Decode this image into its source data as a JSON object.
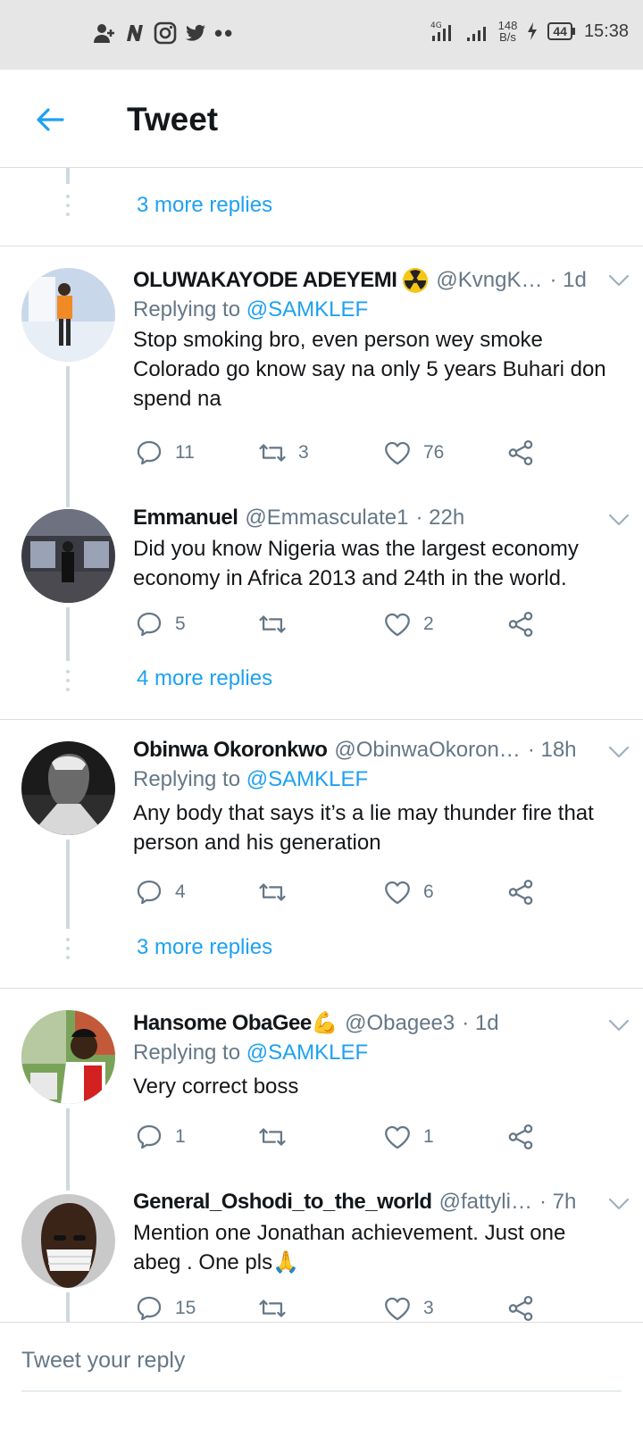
{
  "status_bar": {
    "left_icons": [
      "person-add-icon",
      "n-app-icon",
      "instagram-icon",
      "twitter-icon",
      "more-dots-icon"
    ],
    "network": "4G",
    "speed_value": "148",
    "speed_unit": "B/s",
    "battery": "44",
    "time": "15:38"
  },
  "header": {
    "title": "Tweet",
    "back_icon": "back-arrow-icon"
  },
  "colors": {
    "accent": "#1da1f2",
    "muted": "#657786",
    "text": "#14171a",
    "line": "#cfd9de"
  },
  "top_more_replies": "3 more replies",
  "tweets": [
    {
      "name": "OLUWAKAYODE ADEYEMI",
      "badge": "radioactive-icon",
      "handle": "@KvngK…",
      "time": "· 1d",
      "replying_prefix": "Replying to",
      "replying_to": "@SAMKLEF",
      "text": "Stop smoking bro, even person wey smoke Colorado go know say na only 5 years Buhari don spend na",
      "replies": "11",
      "retweets": "3",
      "likes": "76"
    },
    {
      "name": "Emmanuel",
      "handle": "@Emmasculate1",
      "time": "· 22h",
      "text": "Did you know Nigeria was the largest economy economy in Africa 2013 and 24th in the world.",
      "replies": "5",
      "retweets": "",
      "likes": "2",
      "more_replies": "4 more replies"
    },
    {
      "name": "Obinwa Okoronkwo",
      "handle": "@ObinwaOkoron…",
      "time": "· 18h",
      "replying_prefix": "Replying to",
      "replying_to": "@SAMKLEF",
      "text": "Any body that says it’s a lie may thunder fire that person and his generation",
      "replies": "4",
      "retweets": "",
      "likes": "6",
      "more_replies": "3 more replies"
    },
    {
      "name": "Hansome ObaGee💪",
      "handle": "@Obagee3",
      "time": "· 1d",
      "replying_prefix": "Replying to",
      "replying_to": "@SAMKLEF",
      "text": "Very correct boss",
      "replies": "1",
      "retweets": "",
      "likes": "1"
    },
    {
      "name": "General_Oshodi_to_the_world",
      "handle": "@fattyli…",
      "time": "· 7h",
      "text": "Mention one Jonathan achievement. Just one abeg . One pls🙏",
      "replies": "15",
      "retweets": "",
      "likes": "3"
    }
  ],
  "reply_bar": {
    "placeholder": "Tweet your reply"
  }
}
